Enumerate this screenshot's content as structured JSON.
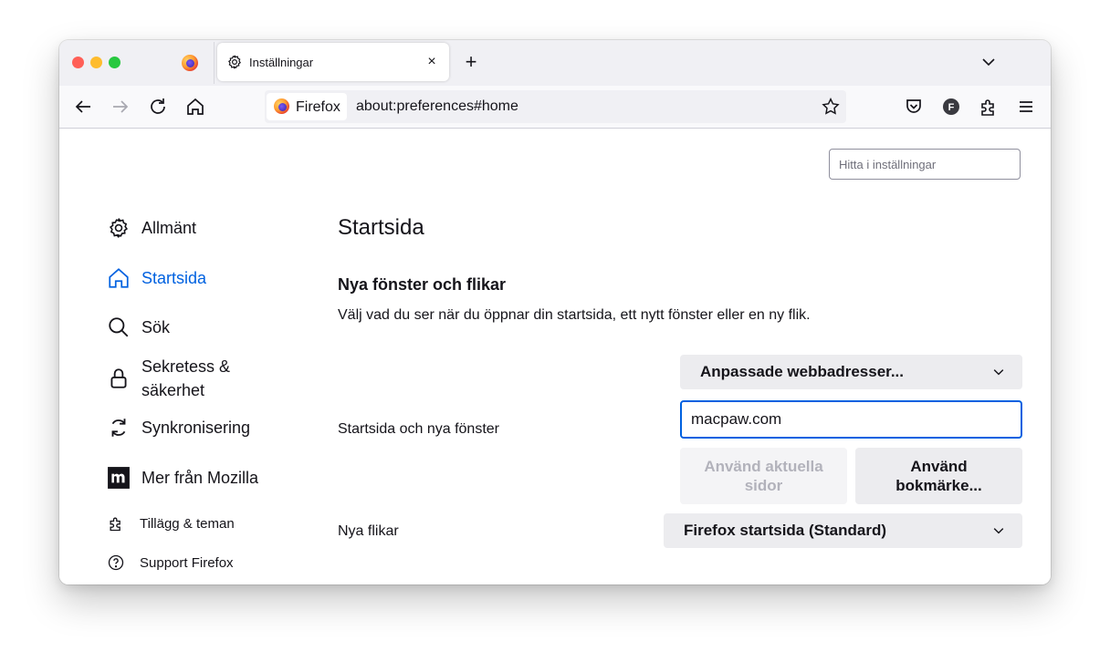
{
  "tab": {
    "title": "Inställningar",
    "close_label": "×",
    "new_tab_label": "+"
  },
  "urlbar": {
    "identity_label": "Firefox",
    "url": "about:preferences#home"
  },
  "search": {
    "placeholder": "Hitta i inställningar"
  },
  "sidebar": {
    "items": [
      {
        "label": "Allmänt",
        "icon": "gear-icon"
      },
      {
        "label": "Startsida",
        "icon": "home-icon",
        "selected": true
      },
      {
        "label": "Sök",
        "icon": "search-icon"
      },
      {
        "label": "Sekretess & säkerhet",
        "icon": "lock-icon"
      },
      {
        "label": "Synkronisering",
        "icon": "sync-icon"
      },
      {
        "label": "Mer från Mozilla",
        "icon": "mozilla-m-icon"
      }
    ],
    "footer": [
      {
        "label": "Tillägg & teman",
        "icon": "puzzle-icon"
      },
      {
        "label": "Support Firefox",
        "icon": "help-icon"
      }
    ]
  },
  "main": {
    "title": "Startsida",
    "section_title": "Nya fönster och flikar",
    "section_desc": "Välj vad du ser när du öppnar din startsida, ett nytt fönster eller en ny flik.",
    "homepage": {
      "label": "Startsida och nya fönster",
      "dropdown_value": "Anpassade webbadresser...",
      "url_value": "macpaw.com",
      "use_current_label": "Använd aktuella sidor",
      "use_bookmark_label": "Använd bokmärke..."
    },
    "newtabs": {
      "label": "Nya flikar",
      "dropdown_value": "Firefox startsida (Standard)"
    }
  },
  "colors": {
    "accent": "#0061e0",
    "traffic_red": "#ff5f57",
    "traffic_yellow": "#febc2e",
    "traffic_green": "#28c840"
  }
}
